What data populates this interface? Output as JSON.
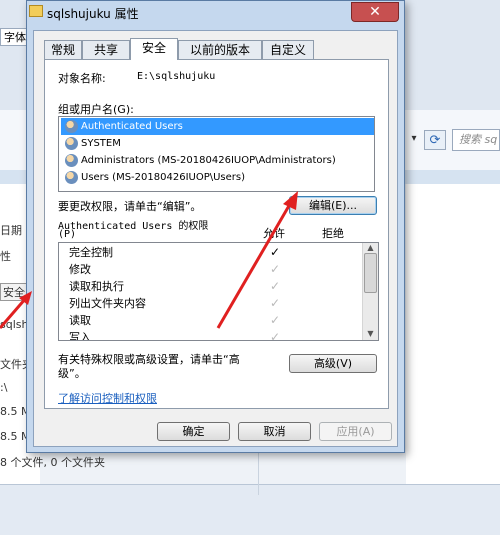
{
  "background": {
    "font_label": "字体",
    "left_col_labels": [
      "日期",
      "性",
      "安全",
      "sqlsh",
      "文件夹",
      ":\\",
      "8.5 M",
      "8.5 M",
      "8 个文件, 0 个文件夹"
    ],
    "search_placeholder": "搜索 sq",
    "accent_color": "#c75050"
  },
  "dialog": {
    "title": "sqlshujuku 属性",
    "close_glyph": "✕",
    "tabs": [
      "常规",
      "共享",
      "安全",
      "以前的版本",
      "自定义"
    ],
    "active_tab": "安全",
    "object_label": "对象名称:",
    "object_value": "E:\\sqlshujuku",
    "group_label": "组或用户名(G):",
    "users": [
      "Authenticated Users",
      "SYSTEM",
      "Administrators (MS-20180426IUOP\\Administrators)",
      "Users (MS-20180426IUOP\\Users)"
    ],
    "selected_user_index": 0,
    "change_hint": "要更改权限，请单击“编辑”。",
    "edit_button": "编辑(E)...",
    "perm_title": "Authenticated Users 的权限",
    "perm_p": "(P)",
    "allow_header": "允许",
    "deny_header": "拒绝",
    "permissions": [
      {
        "name": "完全控制",
        "allow": "✓",
        "inherited": false
      },
      {
        "name": "修改",
        "allow": "✓",
        "inherited": true
      },
      {
        "name": "读取和执行",
        "allow": "✓",
        "inherited": true
      },
      {
        "name": "列出文件夹内容",
        "allow": "✓",
        "inherited": true
      },
      {
        "name": "读取",
        "allow": "✓",
        "inherited": true
      },
      {
        "name": "写入",
        "allow": "✓",
        "inherited": true
      }
    ],
    "advanced_hint_1": "有关特殊权限或高级设置，请单击“高",
    "advanced_hint_2": "级”。",
    "advanced_button": "高级(V)",
    "learn_link": "了解访问控制和权限",
    "ok_button": "确定",
    "cancel_button": "取消",
    "apply_button": "应用(A)"
  }
}
